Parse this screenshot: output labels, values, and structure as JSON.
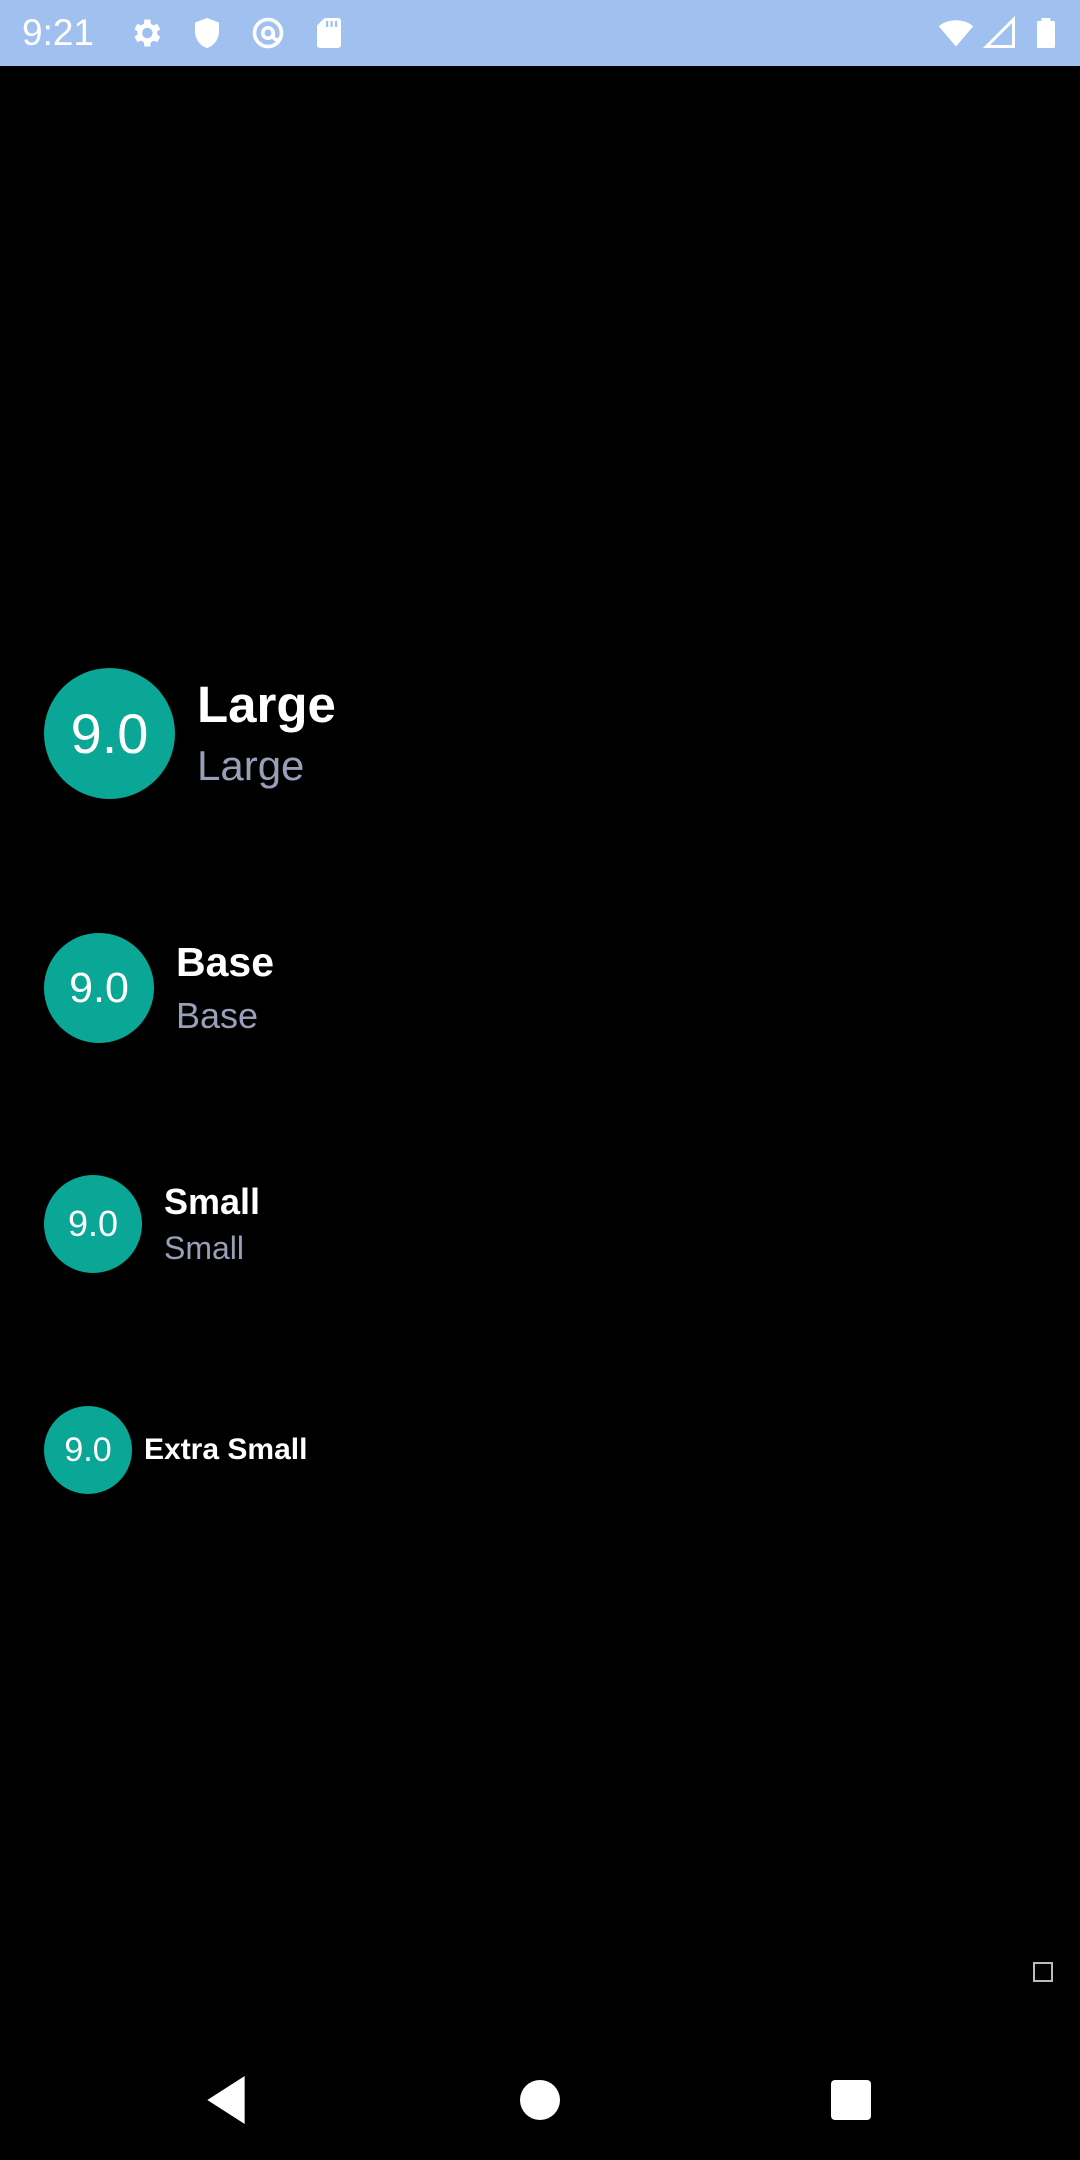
{
  "status_bar": {
    "time": "9:21",
    "left_icons": [
      "gear-icon",
      "shield-icon",
      "at-sign-icon",
      "sd-card-icon"
    ],
    "right_icons": [
      "wifi-icon",
      "signal-icon",
      "battery-icon"
    ],
    "background_color": "#a0c0f0"
  },
  "ratings": [
    {
      "size": "Large",
      "value": "9.0",
      "title": "Large",
      "subtitle": "Large"
    },
    {
      "size": "Base",
      "value": "9.0",
      "title": "Base",
      "subtitle": "Base"
    },
    {
      "size": "Small",
      "value": "9.0",
      "title": "Small",
      "subtitle": "Small"
    },
    {
      "size": "Extra Small",
      "value": "9.0",
      "title": "Extra Small"
    }
  ],
  "colors": {
    "badge": "#0aa696",
    "title": "#ffffff",
    "subtitle": "#9a9fb8",
    "background": "#000000"
  },
  "nav_bar": {
    "buttons": [
      "back-icon",
      "home-icon",
      "recents-icon"
    ]
  }
}
